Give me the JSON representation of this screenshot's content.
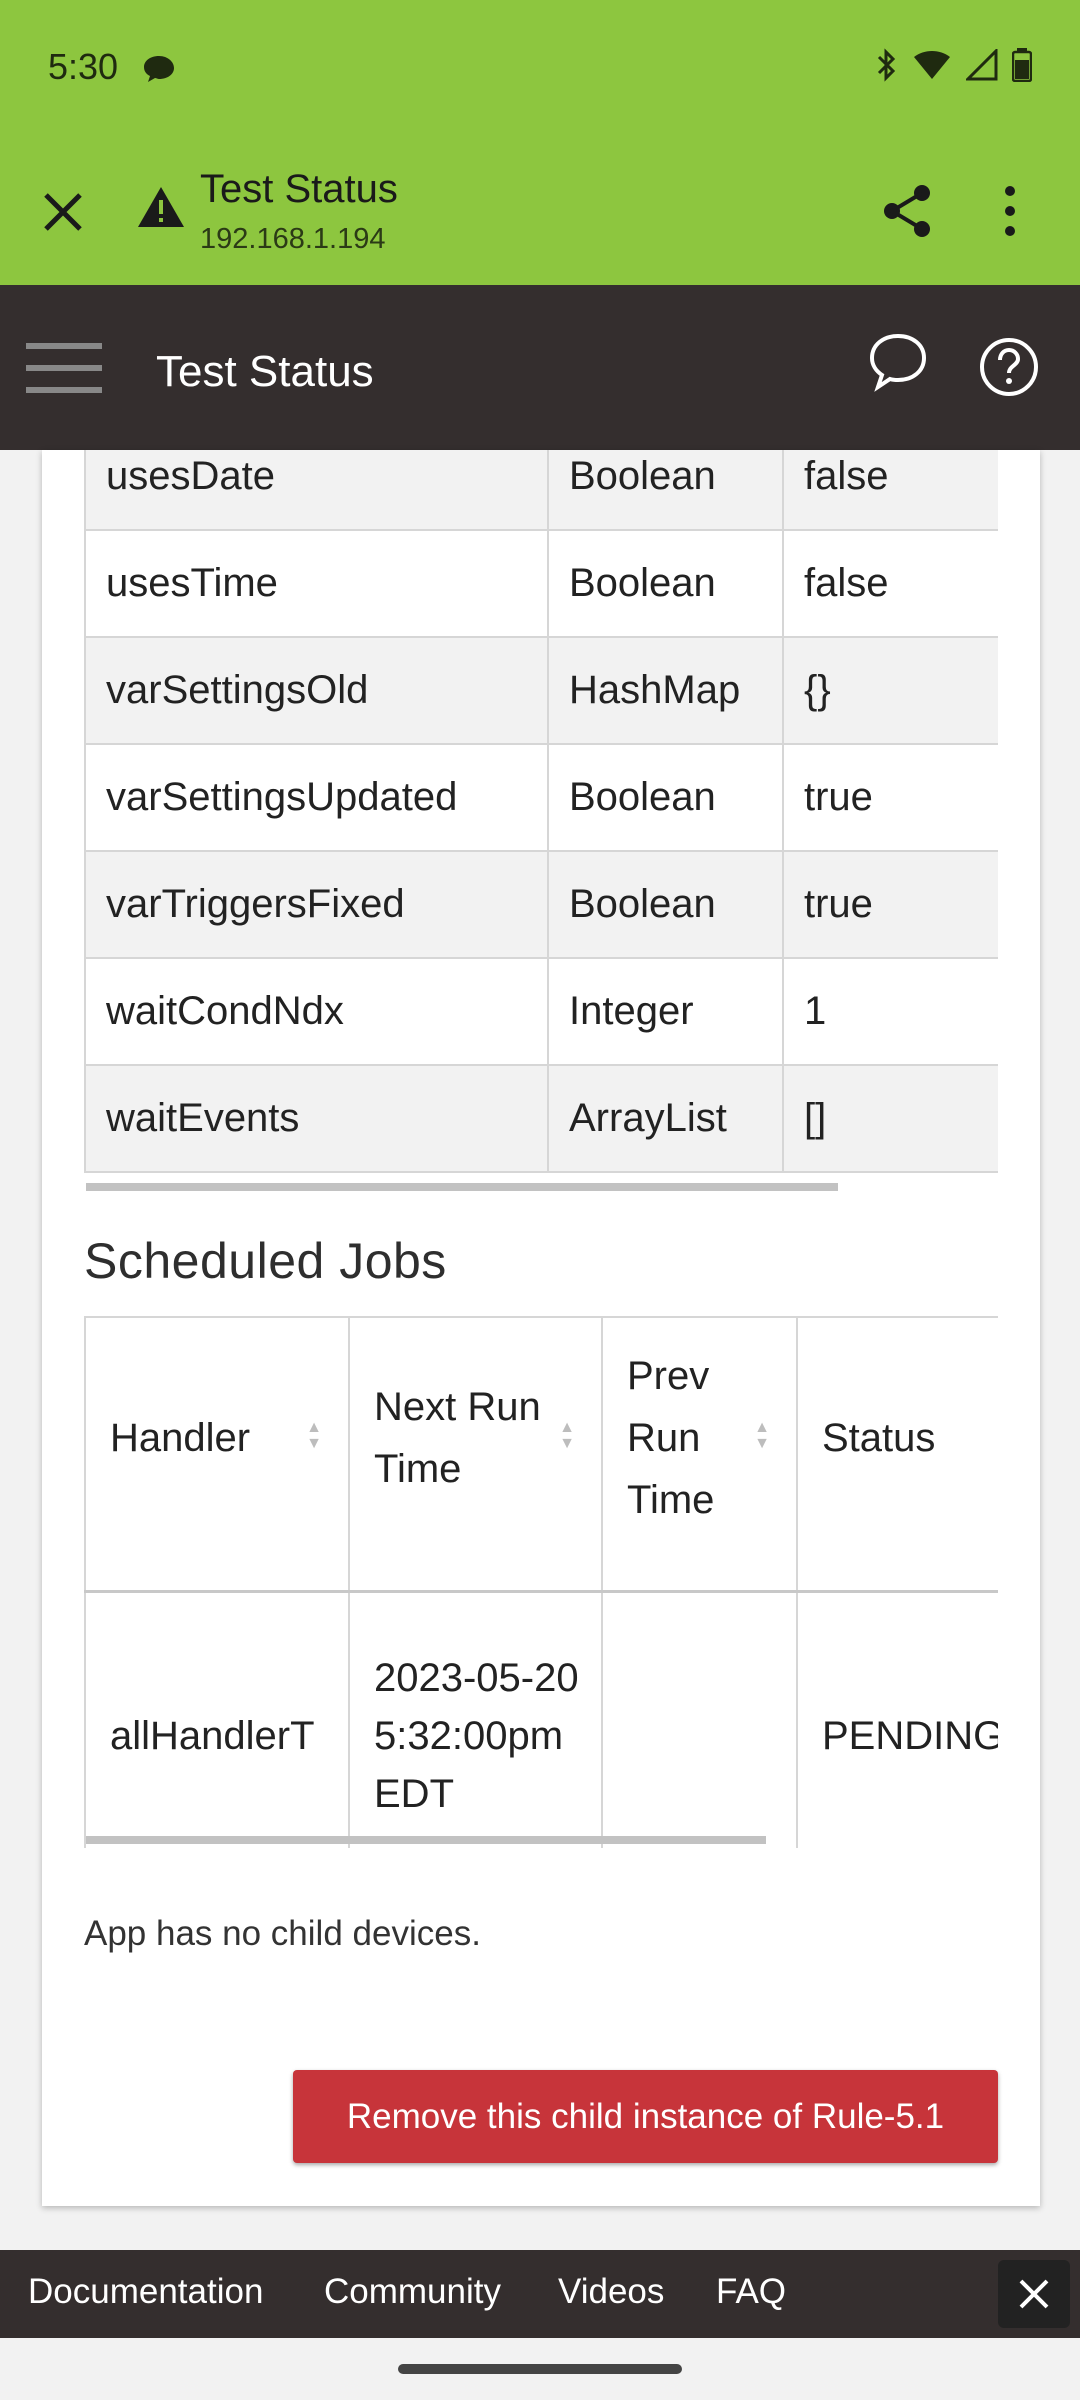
{
  "status_bar": {
    "time": "5:30"
  },
  "browser": {
    "title": "Test Status",
    "url": "192.168.1.194"
  },
  "app_header": {
    "title": "Test Status"
  },
  "variables": [
    {
      "name": "usesDate",
      "type": "Boolean",
      "value": "false"
    },
    {
      "name": "usesTime",
      "type": "Boolean",
      "value": "false"
    },
    {
      "name": "varSettingsOld",
      "type": "HashMap",
      "value": "{}"
    },
    {
      "name": "varSettingsUpdated",
      "type": "Boolean",
      "value": "true"
    },
    {
      "name": "varTriggersFixed",
      "type": "Boolean",
      "value": "true"
    },
    {
      "name": "waitCondNdx",
      "type": "Integer",
      "value": "1"
    },
    {
      "name": "waitEvents",
      "type": "ArrayList",
      "value": "[]"
    }
  ],
  "scheduled_jobs": {
    "title": "Scheduled Jobs",
    "columns": [
      "Handler",
      "Next Run Time",
      "Prev Run Time",
      "Status"
    ],
    "rows": [
      {
        "handler": "allHandlerT",
        "next_run": "2023-05-20 5:32:00pm EDT",
        "prev_run": "",
        "status": "PENDING"
      }
    ]
  },
  "no_children_text": "App has no child devices.",
  "remove_button": "Remove this child instance of Rule-5.1",
  "footer": {
    "links": [
      "Documentation",
      "Community",
      "Videos",
      "FAQ"
    ]
  },
  "colors": {
    "toolbar": "#8dc63f",
    "header": "#342e2e",
    "danger": "#c7343a"
  }
}
